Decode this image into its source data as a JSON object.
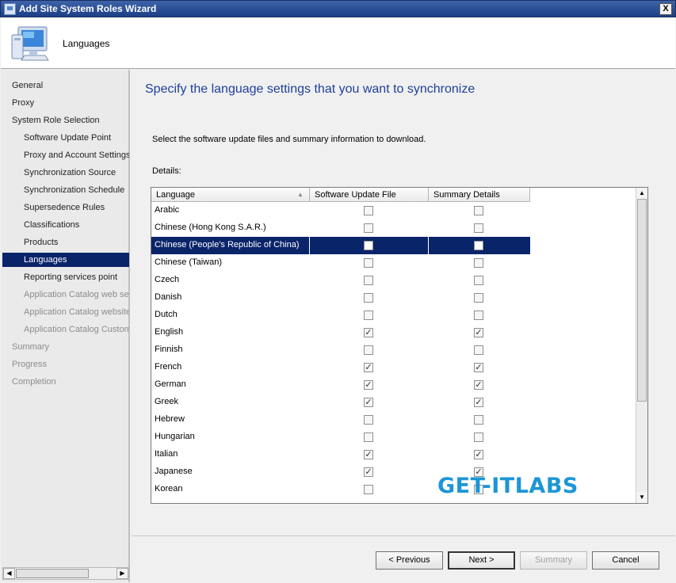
{
  "window": {
    "title": "Add Site System Roles Wizard",
    "close_glyph": "X"
  },
  "header": {
    "title": "Languages",
    "icon": "computer-icon"
  },
  "sidebar": {
    "items": [
      {
        "label": "General",
        "state": "normal",
        "level": 0
      },
      {
        "label": "Proxy",
        "state": "normal",
        "level": 0
      },
      {
        "label": "System Role Selection",
        "state": "normal",
        "level": 0
      },
      {
        "label": "Software Update Point",
        "state": "normal",
        "level": 1
      },
      {
        "label": "Proxy and Account Settings",
        "state": "normal",
        "level": 1
      },
      {
        "label": "Synchronization Source",
        "state": "normal",
        "level": 1
      },
      {
        "label": "Synchronization Schedule",
        "state": "normal",
        "level": 1
      },
      {
        "label": "Supersedence Rules",
        "state": "normal",
        "level": 1
      },
      {
        "label": "Classifications",
        "state": "normal",
        "level": 1
      },
      {
        "label": "Products",
        "state": "normal",
        "level": 1
      },
      {
        "label": "Languages",
        "state": "active",
        "level": 1
      },
      {
        "label": "Reporting services point",
        "state": "normal",
        "level": 1
      },
      {
        "label": "Application Catalog web ser",
        "state": "disabled",
        "level": 1
      },
      {
        "label": "Application Catalog website",
        "state": "disabled",
        "level": 1
      },
      {
        "label": "Application Catalog Customi",
        "state": "disabled",
        "level": 1
      },
      {
        "label": "Summary",
        "state": "disabled",
        "level": 0
      },
      {
        "label": "Progress",
        "state": "disabled",
        "level": 0
      },
      {
        "label": "Completion",
        "state": "disabled",
        "level": 0
      }
    ]
  },
  "main": {
    "title": "Specify the language settings that you want to synchronize",
    "instruction": "Select the software update files and summary information to download.",
    "details_label": "Details:",
    "columns": [
      "Language",
      "Software Update File",
      "Summary Details"
    ],
    "rows": [
      {
        "language": "Arabic",
        "update_file": false,
        "summary": false,
        "selected": false
      },
      {
        "language": "Chinese (Hong Kong S.A.R.)",
        "update_file": false,
        "summary": false,
        "selected": false
      },
      {
        "language": "Chinese (People's Republic of China)",
        "update_file": false,
        "summary": false,
        "selected": true
      },
      {
        "language": "Chinese (Taiwan)",
        "update_file": false,
        "summary": false,
        "selected": false
      },
      {
        "language": "Czech",
        "update_file": false,
        "summary": false,
        "selected": false
      },
      {
        "language": "Danish",
        "update_file": false,
        "summary": false,
        "selected": false
      },
      {
        "language": "Dutch",
        "update_file": false,
        "summary": false,
        "selected": false
      },
      {
        "language": "English",
        "update_file": true,
        "summary": true,
        "selected": false
      },
      {
        "language": "Finnish",
        "update_file": false,
        "summary": false,
        "selected": false
      },
      {
        "language": "French",
        "update_file": true,
        "summary": true,
        "selected": false
      },
      {
        "language": "German",
        "update_file": true,
        "summary": true,
        "selected": false
      },
      {
        "language": "Greek",
        "update_file": true,
        "summary": true,
        "selected": false
      },
      {
        "language": "Hebrew",
        "update_file": false,
        "summary": false,
        "selected": false
      },
      {
        "language": "Hungarian",
        "update_file": false,
        "summary": false,
        "selected": false
      },
      {
        "language": "Italian",
        "update_file": true,
        "summary": true,
        "selected": false
      },
      {
        "language": "Japanese",
        "update_file": true,
        "summary": true,
        "selected": false
      },
      {
        "language": "Korean",
        "update_file": false,
        "summary": false,
        "selected": false
      }
    ]
  },
  "buttons": {
    "previous": "< Previous",
    "next": "Next >",
    "summary": "Summary",
    "cancel": "Cancel"
  },
  "watermark": "GET-ITLABS",
  "colors": {
    "selection": "#0a246a",
    "title_text": "#1f3f99",
    "watermark": "#1c96d6"
  }
}
